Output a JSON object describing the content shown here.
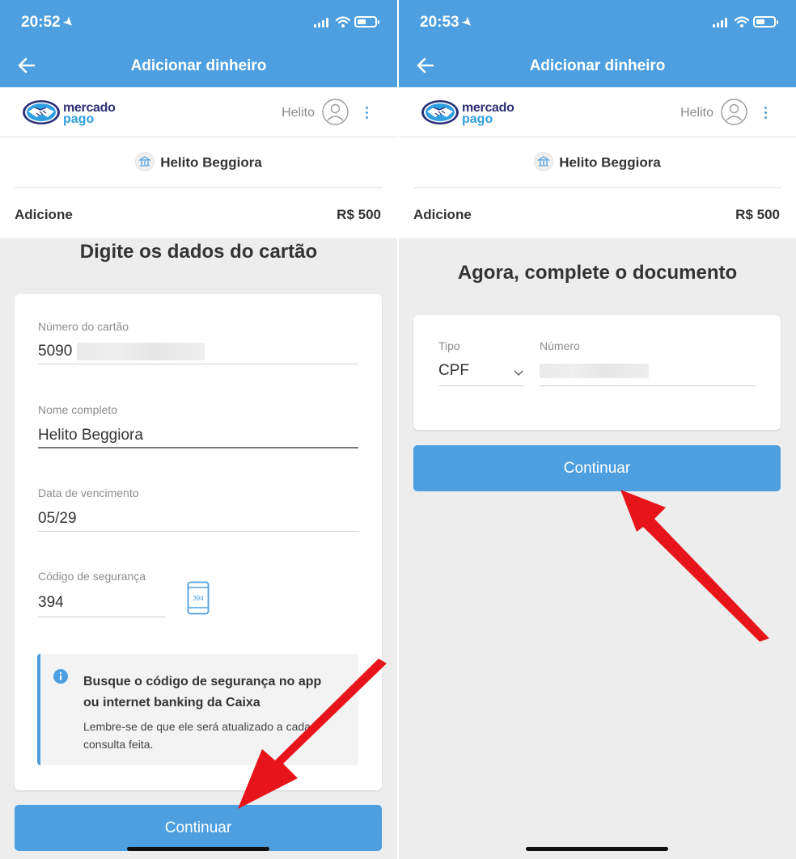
{
  "left": {
    "status_time": "20:52",
    "nav_title": "Adicionar dinheiro",
    "brand": {
      "line1": "mercado",
      "line2": "pago"
    },
    "user_short": "Helito",
    "holder_name": "Helito Beggiora",
    "add_label": "Adicione",
    "add_value": "R$ 500",
    "section_title": "Digite os dados do cartão",
    "fields": {
      "card_number": {
        "label": "Número do cartão",
        "value": "5090"
      },
      "full_name": {
        "label": "Nome completo",
        "value": "Helito Beggiora"
      },
      "expiry": {
        "label": "Data de vencimento",
        "value": "05/29"
      },
      "cvv": {
        "label": "Código de segurança",
        "value": "394"
      }
    },
    "cvv_hint_digits": "394",
    "info": {
      "title": "Busque o código de segurança no app ou internet banking da Caixa",
      "body": "Lembre-se de que ele será atualizado a cada consulta feita."
    },
    "continue_label": "Continuar"
  },
  "right": {
    "status_time": "20:53",
    "nav_title": "Adicionar dinheiro",
    "brand": {
      "line1": "mercado",
      "line2": "pago"
    },
    "user_short": "Helito",
    "holder_name": "Helito Beggiora",
    "add_label": "Adicione",
    "add_value": "R$ 500",
    "section_title": "Agora, complete o documento",
    "fields": {
      "doc_type": {
        "label": "Tipo",
        "value": "CPF"
      },
      "doc_number": {
        "label": "Número",
        "value": ""
      }
    },
    "continue_label": "Continuar"
  },
  "colors": {
    "primary": "#4d9fe0",
    "annotation_arrow": "#e8141b",
    "brand_navy": "#2d3277",
    "brand_blue": "#2f9fe0",
    "background": "#ededed"
  }
}
